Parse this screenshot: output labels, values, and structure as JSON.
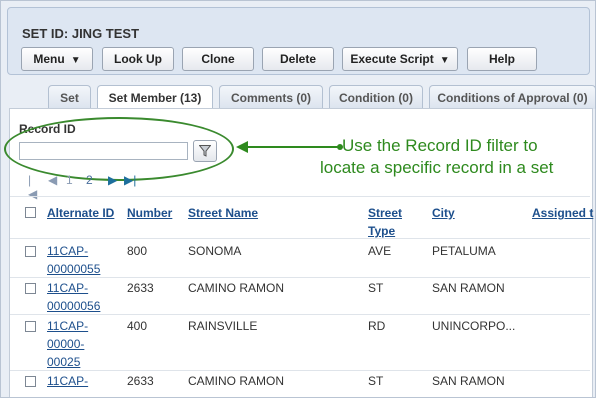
{
  "header": {
    "title": "SET ID: JING TEST"
  },
  "toolbar": {
    "menu": "Menu",
    "lookup": "Look Up",
    "clone": "Clone",
    "delete": "Delete",
    "execute_script": "Execute Script",
    "help": "Help"
  },
  "tabs": [
    "Set",
    "Set Member (13)",
    "Comments (0)",
    "Condition (0)",
    "Conditions of Approval (0)"
  ],
  "filter": {
    "label": "Record ID",
    "value": ""
  },
  "pager": {
    "page1": "1",
    "page2": "2"
  },
  "annotation": {
    "line1": "Use the Record ID filter to",
    "line2": "locate a specific record in a set"
  },
  "table": {
    "headers": {
      "alt_id": "Alternate ID",
      "number": "Number",
      "street_name": "Street Name",
      "street_type_1": "Street",
      "street_type_2": "Type",
      "city": "City",
      "assigned": "Assigned t"
    },
    "rows": [
      {
        "alt1": "11CAP-",
        "alt2": "00000055",
        "alt3": "",
        "number": "800",
        "street": "SONOMA",
        "type": "AVE",
        "city": "PETALUMA"
      },
      {
        "alt1": "11CAP-",
        "alt2": "00000056",
        "alt3": "",
        "number": "2633",
        "street": "CAMINO RAMON",
        "type": "ST",
        "city": "SAN RAMON"
      },
      {
        "alt1": "11CAP-",
        "alt2": "00000-",
        "alt3": "00025",
        "number": "400",
        "street": "RAINSVILLE",
        "type": "RD",
        "city": "UNINCORPO..."
      },
      {
        "alt1": "11CAP-",
        "alt2": "",
        "alt3": "",
        "number": "2633",
        "street": "CAMINO RAMON",
        "type": "ST",
        "city": "SAN RAMON"
      }
    ]
  },
  "colors": {
    "annotation": "#2e8a1e",
    "link": "#1d4f8c"
  }
}
